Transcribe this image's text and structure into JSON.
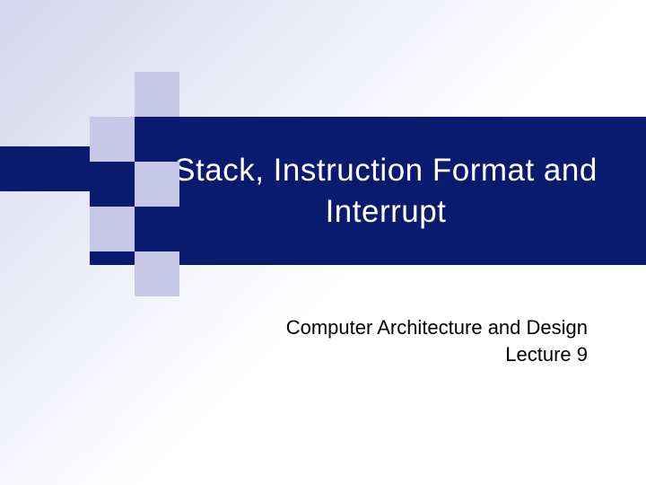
{
  "slide": {
    "title": "Stack, Instruction Format and Interrupt",
    "subtitle_line1": "Computer Architecture and Design",
    "subtitle_line2": "Lecture 9"
  }
}
